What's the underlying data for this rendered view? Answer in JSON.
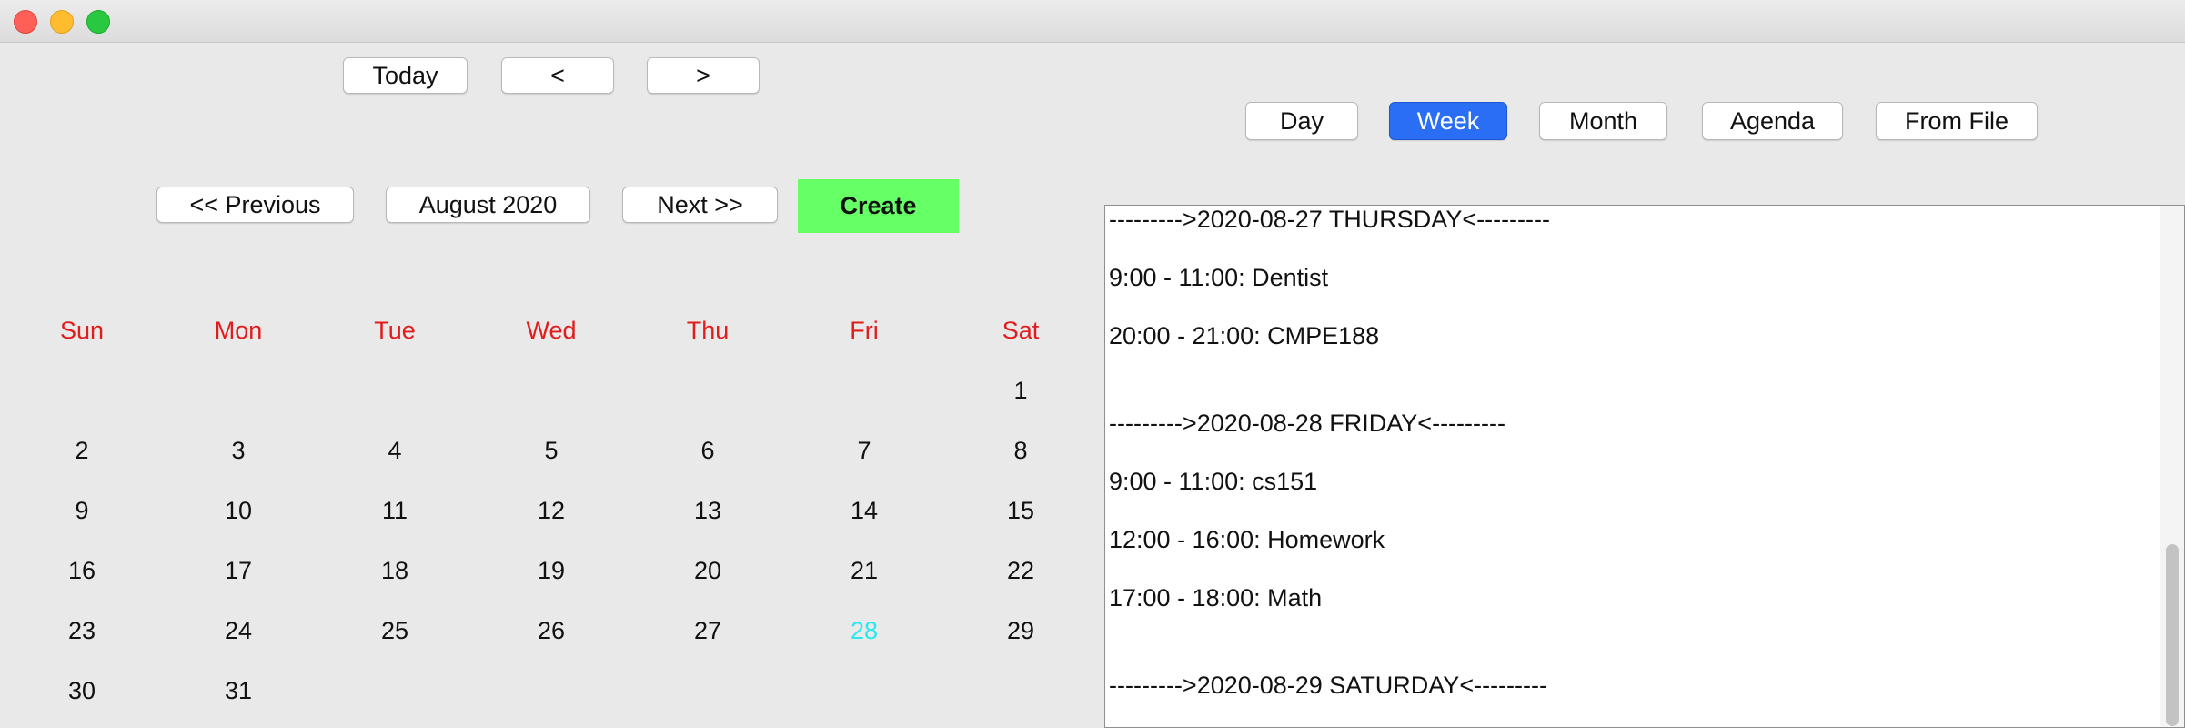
{
  "toolbar": {
    "today": "Today",
    "prev": "<",
    "next": ">"
  },
  "views": {
    "day": "Day",
    "week": "Week",
    "month": "Month",
    "agenda": "Agenda",
    "from_file": "From File",
    "selected": "Week"
  },
  "month_nav": {
    "previous": "<< Previous",
    "current": "August 2020",
    "next": "Next >>",
    "create": "Create"
  },
  "calendar": {
    "day_names": [
      "Sun",
      "Mon",
      "Tue",
      "Wed",
      "Thu",
      "Fri",
      "Sat"
    ],
    "weeks": [
      [
        "",
        "",
        "",
        "",
        "",
        "",
        "1"
      ],
      [
        "2",
        "3",
        "4",
        "5",
        "6",
        "7",
        "8"
      ],
      [
        "9",
        "10",
        "11",
        "12",
        "13",
        "14",
        "15"
      ],
      [
        "16",
        "17",
        "18",
        "19",
        "20",
        "21",
        "22"
      ],
      [
        "23",
        "24",
        "25",
        "26",
        "27",
        "28",
        "29"
      ],
      [
        "30",
        "31",
        "",
        "",
        "",
        "",
        ""
      ]
    ],
    "highlighted_day": "28"
  },
  "agenda": {
    "lines": [
      "--------->2020-08-27 THURSDAY<---------",
      "9:00 - 11:00: Dentist",
      "20:00 - 21:00: CMPE188",
      "--------->2020-08-28 FRIDAY<---------",
      "9:00 - 11:00: cs151",
      "12:00 - 16:00: Homework",
      "17:00 - 18:00: Math",
      "--------->2020-08-29 SATURDAY<---------"
    ]
  },
  "colors": {
    "day_names": "#e11c1c",
    "highlighted_day": "#28e8f0",
    "create_button": "#66ff66",
    "selected_view": "#2a6ef5"
  }
}
